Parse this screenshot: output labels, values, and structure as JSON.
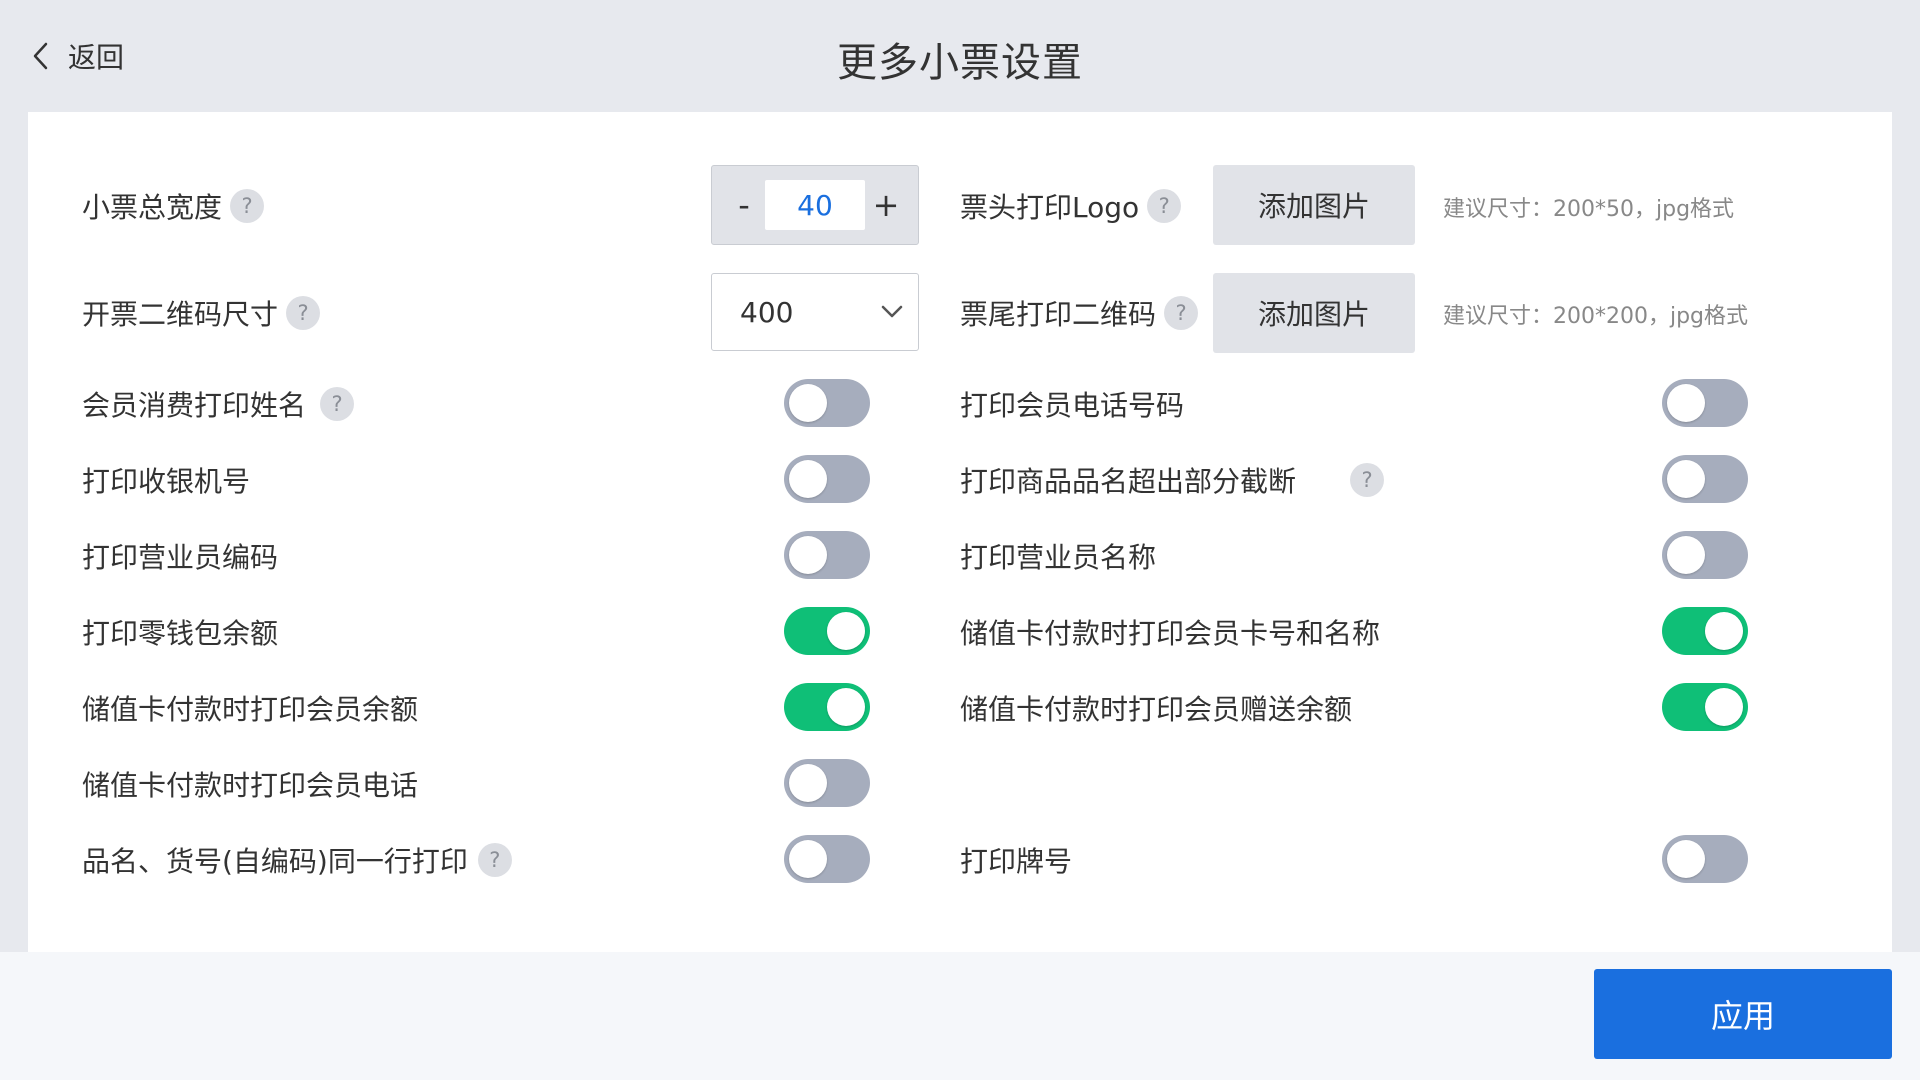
{
  "header": {
    "back_label": "返回",
    "title": "更多小票设置"
  },
  "settings": {
    "receipt_width": {
      "label": "小票总宽度",
      "help": "?",
      "minus": "-",
      "plus": "+",
      "value": "40"
    },
    "qr_size": {
      "label": "开票二维码尺寸",
      "help": "?",
      "value": "400"
    },
    "header_logo": {
      "label": "票头打印Logo",
      "help": "?",
      "button": "添加图片",
      "hint": "建议尺寸：200*50，jpg格式"
    },
    "footer_qr": {
      "label": "票尾打印二维码",
      "help": "?",
      "button": "添加图片",
      "hint": "建议尺寸：200*200，jpg格式"
    }
  },
  "toggles_left": [
    {
      "label": "会员消费打印姓名",
      "help": "?",
      "on": false
    },
    {
      "label": "打印收银机号",
      "on": false
    },
    {
      "label": "打印营业员编码",
      "on": false
    },
    {
      "label": "打印零钱包余额",
      "on": true
    },
    {
      "label": "储值卡付款时打印会员余额",
      "on": true
    },
    {
      "label": "储值卡付款时打印会员电话",
      "on": false
    },
    {
      "label": "品名、货号(自编码)同一行打印",
      "help": "?",
      "on": false
    }
  ],
  "toggles_right": [
    {
      "label": "打印会员电话号码",
      "on": false
    },
    {
      "label": "打印商品品名超出部分截断",
      "help": "?",
      "on": false
    },
    {
      "label": "打印营业员名称",
      "on": false
    },
    {
      "label": "储值卡付款时打印会员卡号和名称",
      "on": true
    },
    {
      "label": "储值卡付款时打印会员赠送余额",
      "on": true
    },
    {
      "label": "打印牌号",
      "on": false
    }
  ],
  "footer": {
    "apply_label": "应用"
  },
  "colors": {
    "accent": "#1a6fdf",
    "toggle_on": "#0fbf77",
    "toggle_off": "#a6adbd"
  }
}
